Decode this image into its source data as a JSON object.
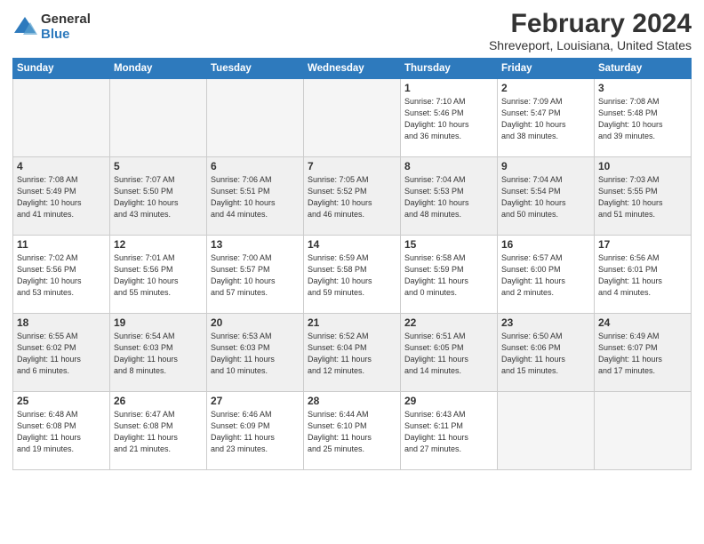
{
  "header": {
    "logo": {
      "general": "General",
      "blue": "Blue"
    },
    "title": "February 2024",
    "subtitle": "Shreveport, Louisiana, United States"
  },
  "weekdays": [
    "Sunday",
    "Monday",
    "Tuesday",
    "Wednesday",
    "Thursday",
    "Friday",
    "Saturday"
  ],
  "weeks": [
    [
      {
        "day": "",
        "info": ""
      },
      {
        "day": "",
        "info": ""
      },
      {
        "day": "",
        "info": ""
      },
      {
        "day": "",
        "info": ""
      },
      {
        "day": "1",
        "info": "Sunrise: 7:10 AM\nSunset: 5:46 PM\nDaylight: 10 hours\nand 36 minutes."
      },
      {
        "day": "2",
        "info": "Sunrise: 7:09 AM\nSunset: 5:47 PM\nDaylight: 10 hours\nand 38 minutes."
      },
      {
        "day": "3",
        "info": "Sunrise: 7:08 AM\nSunset: 5:48 PM\nDaylight: 10 hours\nand 39 minutes."
      }
    ],
    [
      {
        "day": "4",
        "info": "Sunrise: 7:08 AM\nSunset: 5:49 PM\nDaylight: 10 hours\nand 41 minutes."
      },
      {
        "day": "5",
        "info": "Sunrise: 7:07 AM\nSunset: 5:50 PM\nDaylight: 10 hours\nand 43 minutes."
      },
      {
        "day": "6",
        "info": "Sunrise: 7:06 AM\nSunset: 5:51 PM\nDaylight: 10 hours\nand 44 minutes."
      },
      {
        "day": "7",
        "info": "Sunrise: 7:05 AM\nSunset: 5:52 PM\nDaylight: 10 hours\nand 46 minutes."
      },
      {
        "day": "8",
        "info": "Sunrise: 7:04 AM\nSunset: 5:53 PM\nDaylight: 10 hours\nand 48 minutes."
      },
      {
        "day": "9",
        "info": "Sunrise: 7:04 AM\nSunset: 5:54 PM\nDaylight: 10 hours\nand 50 minutes."
      },
      {
        "day": "10",
        "info": "Sunrise: 7:03 AM\nSunset: 5:55 PM\nDaylight: 10 hours\nand 51 minutes."
      }
    ],
    [
      {
        "day": "11",
        "info": "Sunrise: 7:02 AM\nSunset: 5:56 PM\nDaylight: 10 hours\nand 53 minutes."
      },
      {
        "day": "12",
        "info": "Sunrise: 7:01 AM\nSunset: 5:56 PM\nDaylight: 10 hours\nand 55 minutes."
      },
      {
        "day": "13",
        "info": "Sunrise: 7:00 AM\nSunset: 5:57 PM\nDaylight: 10 hours\nand 57 minutes."
      },
      {
        "day": "14",
        "info": "Sunrise: 6:59 AM\nSunset: 5:58 PM\nDaylight: 10 hours\nand 59 minutes."
      },
      {
        "day": "15",
        "info": "Sunrise: 6:58 AM\nSunset: 5:59 PM\nDaylight: 11 hours\nand 0 minutes."
      },
      {
        "day": "16",
        "info": "Sunrise: 6:57 AM\nSunset: 6:00 PM\nDaylight: 11 hours\nand 2 minutes."
      },
      {
        "day": "17",
        "info": "Sunrise: 6:56 AM\nSunset: 6:01 PM\nDaylight: 11 hours\nand 4 minutes."
      }
    ],
    [
      {
        "day": "18",
        "info": "Sunrise: 6:55 AM\nSunset: 6:02 PM\nDaylight: 11 hours\nand 6 minutes."
      },
      {
        "day": "19",
        "info": "Sunrise: 6:54 AM\nSunset: 6:03 PM\nDaylight: 11 hours\nand 8 minutes."
      },
      {
        "day": "20",
        "info": "Sunrise: 6:53 AM\nSunset: 6:03 PM\nDaylight: 11 hours\nand 10 minutes."
      },
      {
        "day": "21",
        "info": "Sunrise: 6:52 AM\nSunset: 6:04 PM\nDaylight: 11 hours\nand 12 minutes."
      },
      {
        "day": "22",
        "info": "Sunrise: 6:51 AM\nSunset: 6:05 PM\nDaylight: 11 hours\nand 14 minutes."
      },
      {
        "day": "23",
        "info": "Sunrise: 6:50 AM\nSunset: 6:06 PM\nDaylight: 11 hours\nand 15 minutes."
      },
      {
        "day": "24",
        "info": "Sunrise: 6:49 AM\nSunset: 6:07 PM\nDaylight: 11 hours\nand 17 minutes."
      }
    ],
    [
      {
        "day": "25",
        "info": "Sunrise: 6:48 AM\nSunset: 6:08 PM\nDaylight: 11 hours\nand 19 minutes."
      },
      {
        "day": "26",
        "info": "Sunrise: 6:47 AM\nSunset: 6:08 PM\nDaylight: 11 hours\nand 21 minutes."
      },
      {
        "day": "27",
        "info": "Sunrise: 6:46 AM\nSunset: 6:09 PM\nDaylight: 11 hours\nand 23 minutes."
      },
      {
        "day": "28",
        "info": "Sunrise: 6:44 AM\nSunset: 6:10 PM\nDaylight: 11 hours\nand 25 minutes."
      },
      {
        "day": "29",
        "info": "Sunrise: 6:43 AM\nSunset: 6:11 PM\nDaylight: 11 hours\nand 27 minutes."
      },
      {
        "day": "",
        "info": ""
      },
      {
        "day": "",
        "info": ""
      }
    ]
  ]
}
